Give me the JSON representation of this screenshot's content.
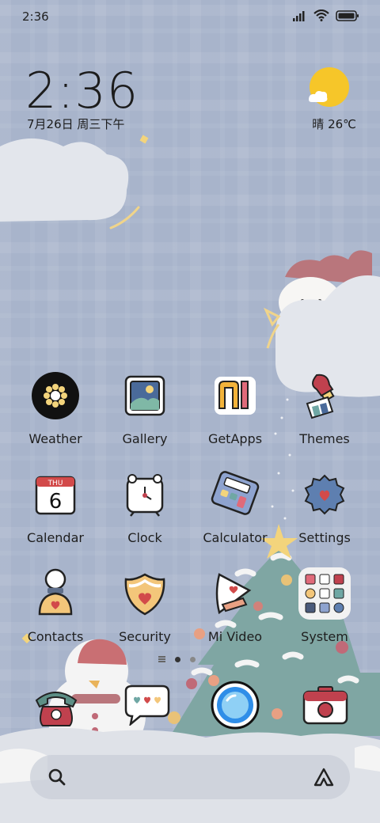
{
  "status_bar": {
    "time": "2:36",
    "icons": [
      "signal-icon",
      "wifi-icon",
      "battery-icon"
    ]
  },
  "clock_widget": {
    "time": "2:36",
    "date": "7月26日 周三下午"
  },
  "weather_widget": {
    "condition_icon": "sun-cloud-icon",
    "text": "晴 26℃"
  },
  "apps": [
    {
      "label": "Weather",
      "icon": "weather-icon"
    },
    {
      "label": "Gallery",
      "icon": "gallery-icon"
    },
    {
      "label": "GetApps",
      "icon": "getapps-icon"
    },
    {
      "label": "Themes",
      "icon": "themes-icon"
    },
    {
      "label": "Calendar",
      "icon": "calendar-icon",
      "icon_day": "THU",
      "icon_date": "6"
    },
    {
      "label": "Clock",
      "icon": "clock-icon"
    },
    {
      "label": "Calculator",
      "icon": "calculator-icon"
    },
    {
      "label": "Settings",
      "icon": "settings-icon"
    },
    {
      "label": "Contacts",
      "icon": "contacts-icon"
    },
    {
      "label": "Security",
      "icon": "security-icon"
    },
    {
      "label": "Mi Video",
      "icon": "mi-video-icon"
    },
    {
      "label": "System",
      "icon": "system-folder-icon"
    }
  ],
  "page_indicator": {
    "pages": 2,
    "current": 1
  },
  "dock": [
    {
      "name": "phone",
      "icon": "phone-icon"
    },
    {
      "name": "messages",
      "icon": "messages-icon"
    },
    {
      "name": "browser",
      "icon": "browser-icon"
    },
    {
      "name": "camera",
      "icon": "camera-icon"
    }
  ],
  "search": {
    "icon": "search-icon",
    "assistant_icon": "assistant-icon"
  },
  "colors": {
    "wallpaper": "#a8b4cb",
    "sun": "#f6c629",
    "tree": "#7fa6a3",
    "snow": "#f4f4f4"
  }
}
